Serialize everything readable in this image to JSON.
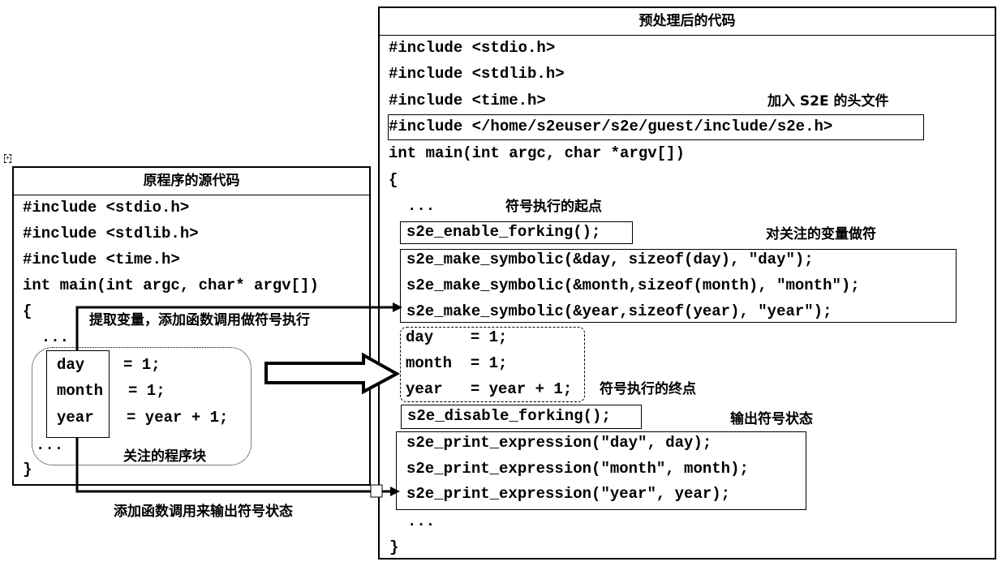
{
  "left_panel": {
    "title": "原程序的源代码",
    "lines": [
      "#include <stdio.h>",
      "#include <stdlib.h>",
      "#include <time.h>",
      "int main(int argc, char* argv[])",
      "{",
      "  ...",
      "}"
    ],
    "block": {
      "vars": [
        "day",
        "month",
        "year"
      ],
      "rhs": [
        "= 1;",
        "= 1;",
        "= year + 1;"
      ],
      "trailing": "...",
      "label": "关注的程序块"
    }
  },
  "right_panel": {
    "title": "预处理后的代码",
    "includes": [
      "#include <stdio.h>",
      "#include <stdlib.h>",
      "#include <time.h>"
    ],
    "s2e_include": "#include </home/s2euser/s2e/guest/include/s2e.h>",
    "main_sig": "int main(int argc, char *argv[])",
    "open_brace": "{",
    "ellipsis_top": "...",
    "enable_forking": "s2e_enable_forking();",
    "make_symbolic": [
      "s2e_make_symbolic(&day, sizeof(day), \"day\");",
      "s2e_make_symbolic(&month,sizeof(month), \"month\");",
      "s2e_make_symbolic(&year,sizeof(year), \"year\");"
    ],
    "assignments": [
      "day    = 1;",
      "month  = 1;",
      "year   = year + 1;"
    ],
    "disable_forking": "s2e_disable_forking();",
    "print_expression": [
      "s2e_print_expression(\"day\", day);",
      "s2e_print_expression(\"month\", month);",
      "s2e_print_expression(\"year\", year);"
    ],
    "ellipsis_bottom": "...",
    "close_brace": "}"
  },
  "annotations": {
    "s2e_header": "加入 S2E 的头文件",
    "sym_start": "符号执行的起点",
    "make_symbolic_note": "对关注的变量做符",
    "sym_end": "符号执行的终点",
    "output_state": "输出符号状态",
    "extract_vars": "提取变量，添加函数调用做符号执行",
    "add_output_calls": "添加函数调用来输出符号状态"
  }
}
